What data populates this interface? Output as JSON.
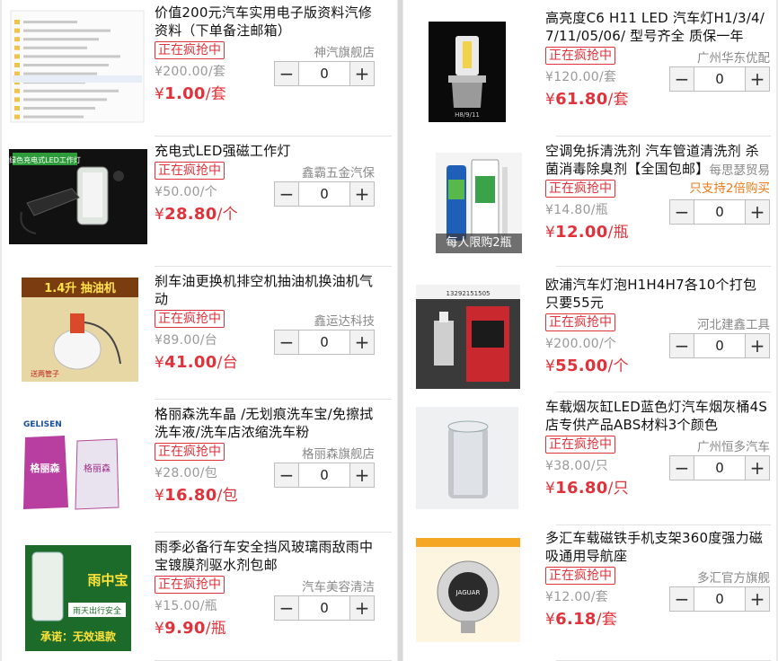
{
  "status_tag": "正在疯抢中",
  "left": [
    {
      "title": "价值200元汽车实用电子版资料汽修资料（下单备注邮箱）",
      "shop": "神汽旗舰店",
      "orig": "¥200.00/套",
      "price": "1.00",
      "unit": "/套",
      "qty": "0"
    },
    {
      "title": "充电式LED强磁工作灯",
      "shop": "鑫霸五金汽保",
      "orig": "¥50.00/个",
      "price": "28.80",
      "unit": "/个",
      "qty": "0"
    },
    {
      "title": "刹车油更换机排空机抽油机换油机气动",
      "shop": "鑫运达科技",
      "orig": "¥89.00/台",
      "price": "41.00",
      "unit": "/台",
      "qty": "0"
    },
    {
      "title": "格丽森洗车晶 /无划痕洗车宝/免擦拭洗车液/洗车店浓缩洗车粉",
      "shop": "格丽森旗舰店",
      "orig": "¥28.00/包",
      "price": "16.80",
      "unit": "/包",
      "qty": "0"
    },
    {
      "title": "雨季必备行车安全挡风玻璃雨敌雨中宝镀膜剂驱水剂包邮",
      "shop": "汽车美容清洁",
      "orig": "¥15.00/瓶",
      "price": "9.90",
      "unit": "/瓶",
      "qty": "0"
    }
  ],
  "right": [
    {
      "title": "高亮度C6 H11 LED 汽车灯H1/3/4/7/11/05/06/ 型号齐全 质保一年",
      "shop": "广州华东优配",
      "orig": "¥120.00/套",
      "price": "61.80",
      "unit": "/套",
      "qty": "0"
    },
    {
      "title": "空调免拆清洗剂 汽车管道清洗剂 杀菌消毒除臭剂【全国包邮】",
      "shop": "每思瑟贸易",
      "note": "只支持2倍购买",
      "badge": "每人限购2瓶",
      "orig": "¥14.80/瓶",
      "price": "12.00",
      "unit": "/瓶",
      "qty": "0"
    },
    {
      "title": "欧浦汽车灯泡H1H4H7各10个打包只要55元",
      "shop": "河北建鑫工具",
      "orig": "¥200.00/个",
      "price": "55.00",
      "unit": "/个",
      "qty": "0"
    },
    {
      "title": "车载烟灰缸LED蓝色灯汽车烟灰桶4S店专供产品ABS材料3个颜色",
      "shop": "广州恒多汽车",
      "orig": "¥38.00/只",
      "price": "16.80",
      "unit": "/只",
      "qty": "0"
    },
    {
      "title": "多汇车载磁铁手机支架360度强力磁吸通用导航座",
      "shop": "多汇官方旗舰",
      "orig": "¥12.00/套",
      "price": "6.18",
      "unit": "/套",
      "qty": "0"
    }
  ],
  "images": {
    "worklight_caption": "绿色充电式LED工作灯",
    "oil_caption_big": "1.4升 抽油机",
    "oil_caption_small": "送两管子",
    "gelisen_brand": "GELISEN",
    "gelisen_pack": "格丽森",
    "rain_brand": "雨中宝",
    "rain_slogan": "雨天出行安全",
    "rain_promise": "承诺：无效退款",
    "headlight_model": "H8/9/11",
    "bulb_phone": "13292151505",
    "holder_brand": "JAGUAR"
  },
  "colors": {
    "accent": "#e0323a",
    "note": "#f07a18",
    "muted": "#999999"
  },
  "icons": {
    "minus": "minus-icon",
    "plus": "plus-icon"
  }
}
